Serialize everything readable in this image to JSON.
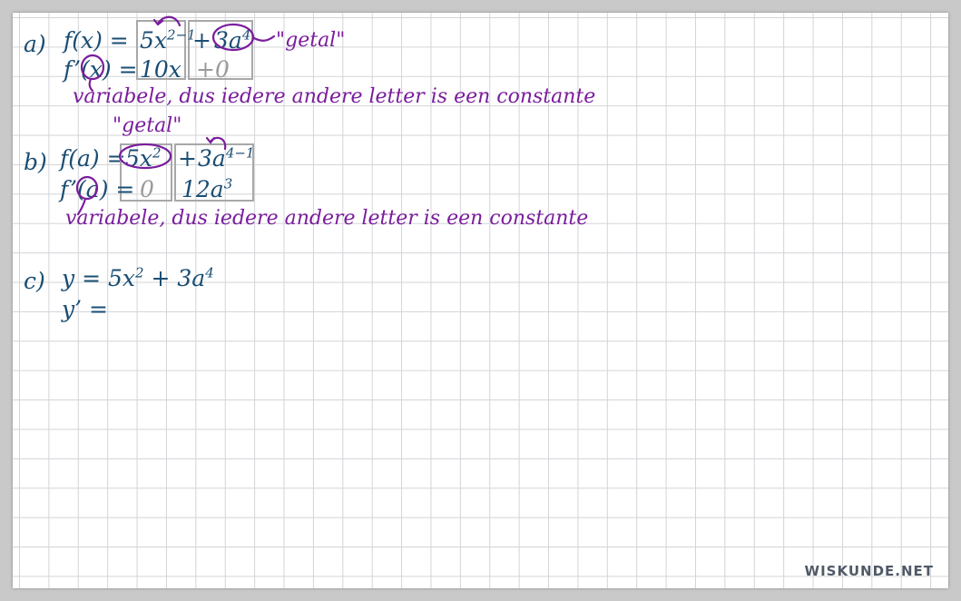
{
  "part_a": {
    "label": "a)",
    "f_lhs": "f(x) =",
    "term1_base": "5x",
    "term1_exp": "2−1",
    "plus": "+",
    "term2_base": "3a",
    "term2_exp": "4",
    "getal": "\"getal\"",
    "fprime_prefix": "f’(",
    "fprime_var": "x",
    "fprime_suffix": ") =",
    "d1": "10x",
    "d2": "+0",
    "note": "variabele, dus iedere andere letter is een constante"
  },
  "part_b": {
    "label": "b)",
    "getal": "\"getal\"",
    "f_lhs": "f(a) =",
    "term1_base": "5x",
    "term1_exp": "2",
    "plus": "+",
    "term2_base": "3a",
    "term2_exp": "4−1",
    "fprime_prefix": "f’(",
    "fprime_var": "a",
    "fprime_suffix": ") =",
    "d1": "0",
    "d2_base": "12a",
    "d2_exp": "3",
    "note": "variabele, dus iedere andere letter is een constante"
  },
  "part_c": {
    "label": "c)",
    "line1_prefix": "y = 5x",
    "line1_exp1": "2",
    "line1_mid": " + 3a",
    "line1_exp2": "4",
    "line2": "y’ ="
  },
  "brand": "WISKUNDE.NET",
  "colors": {
    "ink_blue": "#1a4d73",
    "ink_purple": "#7a1d9c",
    "box_gray": "#a8a8a8"
  }
}
